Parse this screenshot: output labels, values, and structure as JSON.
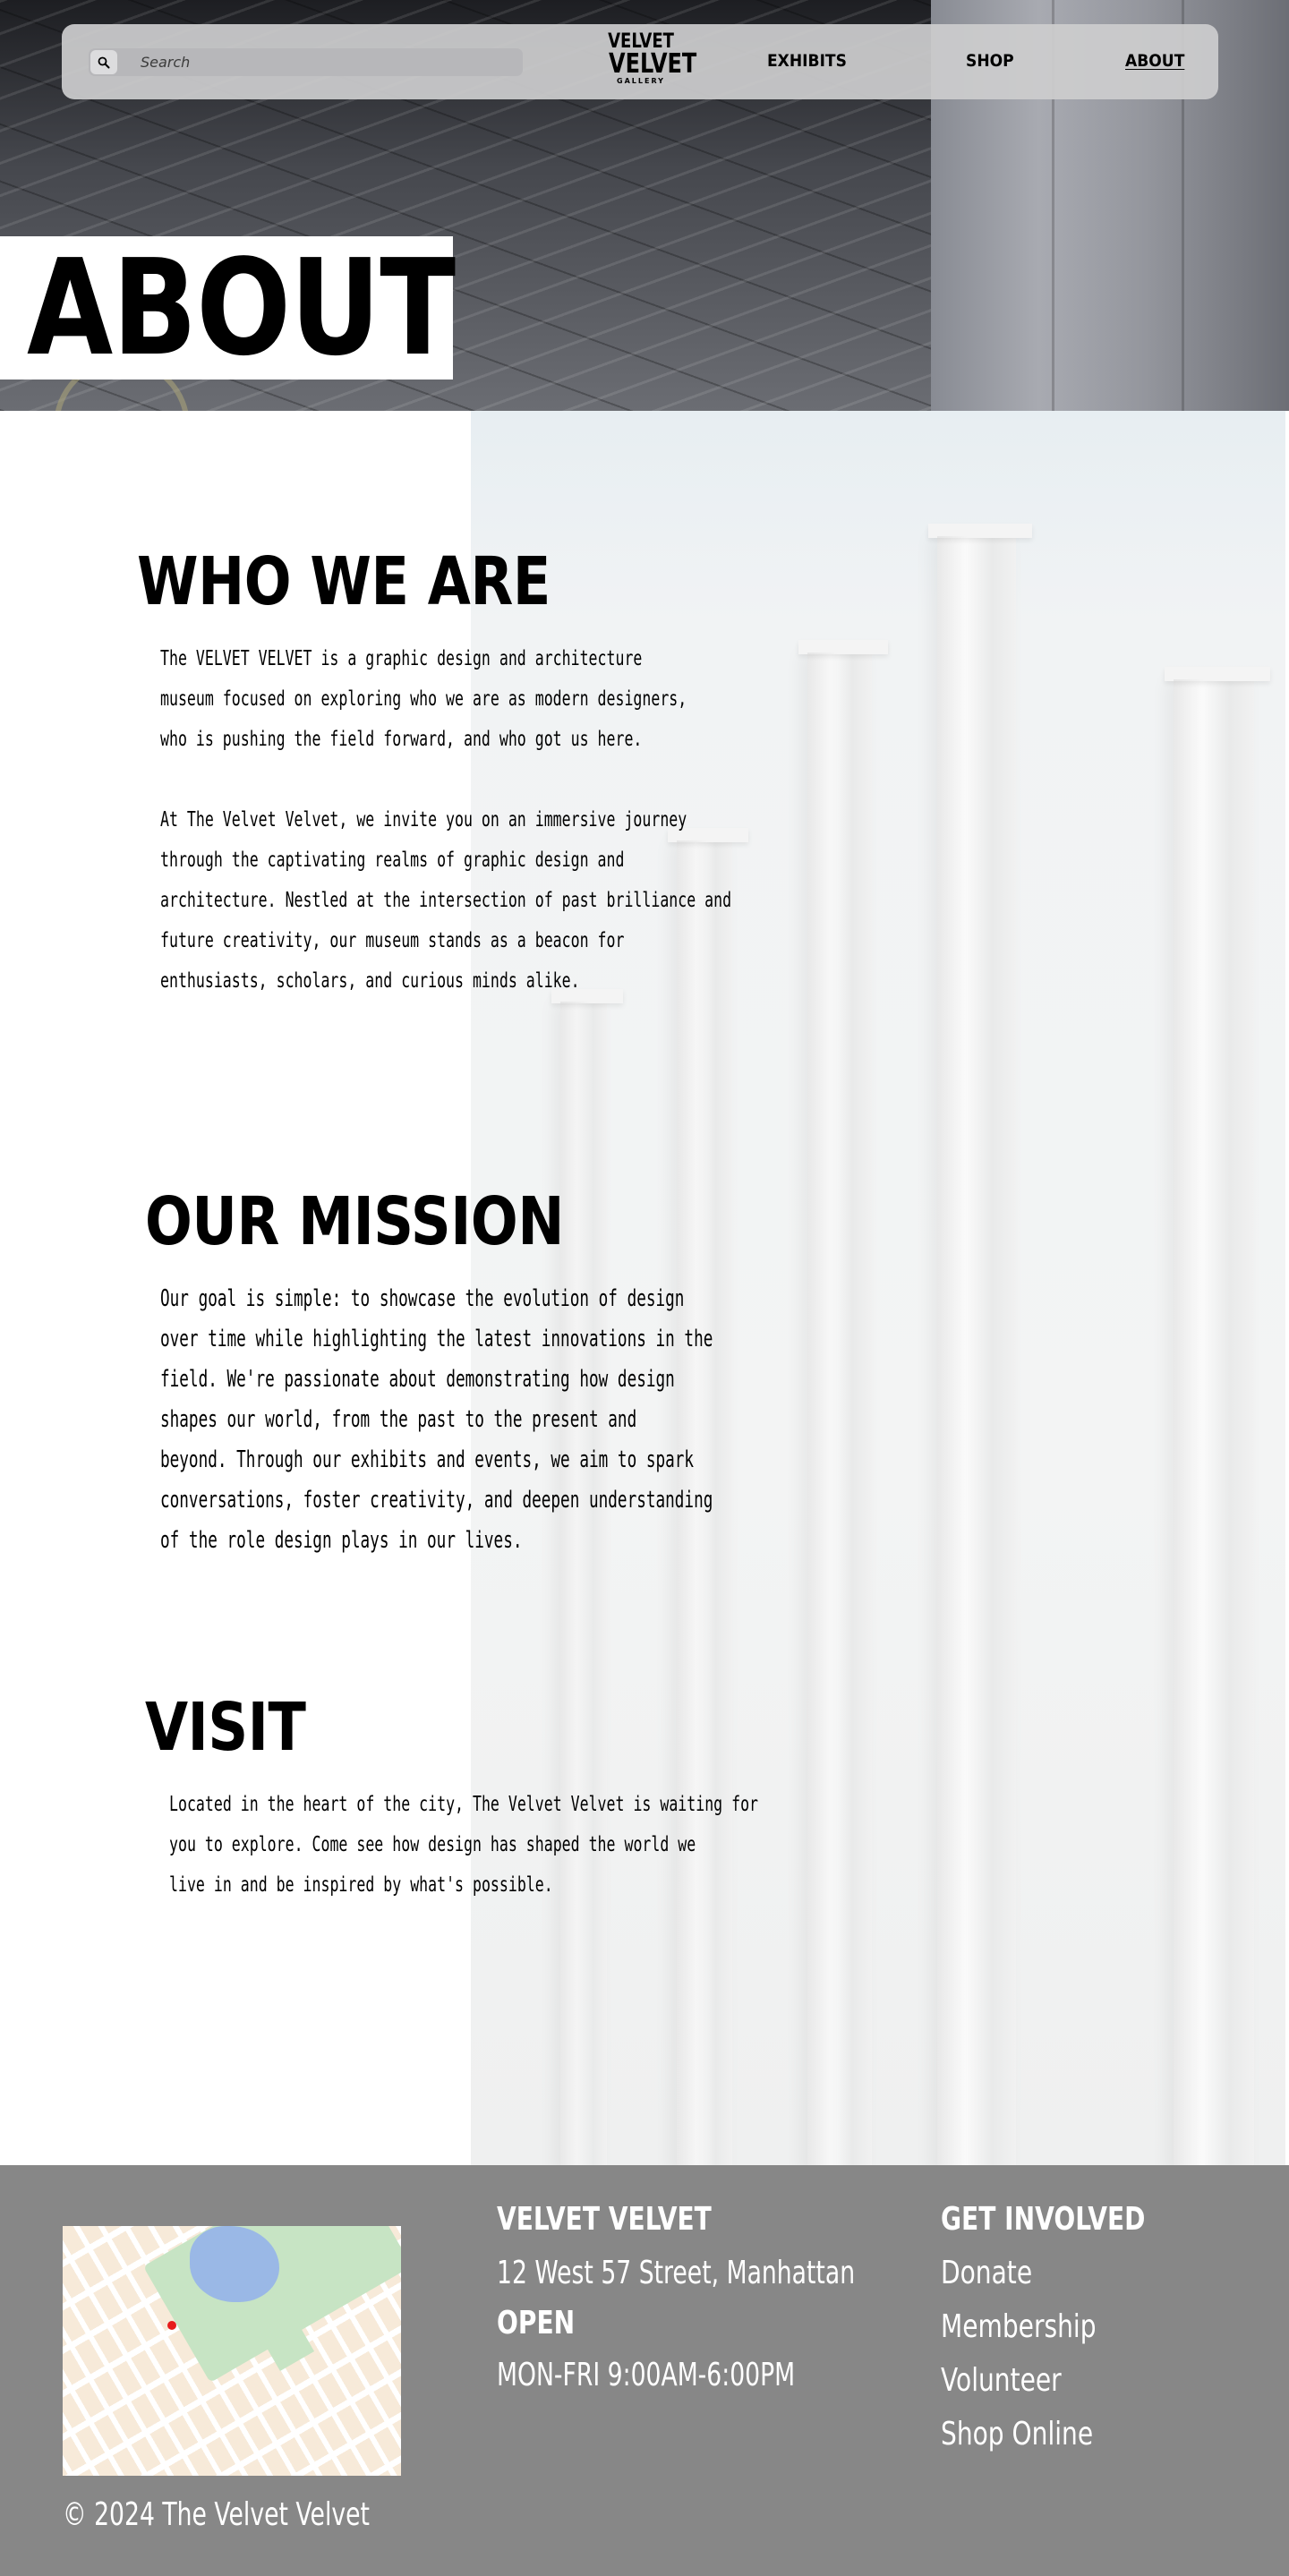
{
  "nav": {
    "search_placeholder": "Search",
    "logo_line1": "VELVET",
    "logo_line2": "VELVET",
    "logo_line3": "GALLERY",
    "links": [
      {
        "label": "EXHIBITS",
        "active": false
      },
      {
        "label": "SHOP",
        "active": false
      },
      {
        "label": "ABOUT",
        "active": true
      }
    ]
  },
  "hero": {
    "title": "ABOUT"
  },
  "sections": {
    "who": {
      "heading": "WHO WE ARE",
      "p1": "The VELVET VELVET is a graphic design and architecture\nmuseum focused on exploring who we are as modern designers,\nwho is pushing the field forward, and who got us here.",
      "p2": "At The Velvet Velvet, we invite you on an immersive journey\nthrough the captivating realms of graphic design and\narchitecture. Nestled at the intersection of past brilliance and\nfuture creativity, our museum stands as a beacon for\nenthusiasts, scholars, and curious minds alike."
    },
    "mission": {
      "heading": "OUR MISSION",
      "p1": "Our goal is simple: to showcase the evolution of design\nover time while highlighting the latest innovations in the\nfield. We're passionate about demonstrating how design\nshapes our world, from the past to the present and\nbeyond. Through our exhibits and events, we aim to spark\nconversations, foster creativity, and deepen understanding\nof the role design plays in our lives."
    },
    "visit": {
      "heading": "VISIT",
      "p1": "Located in the heart of the city, The Velvet Velvet is waiting for\nyou to explore. Come see how design has shaped the world we\nlive in and be inspired by what's possible."
    }
  },
  "footer": {
    "name": "VELVET VELVET",
    "address": "12 West 57 Street, Manhattan",
    "open_label": "OPEN",
    "hours": "MON-FRI 9:00AM-6:00PM",
    "get_involved_title": "GET INVOLVED",
    "links": [
      "Donate",
      "Membership",
      "Volunteer",
      "Shop Online"
    ],
    "copyright": "© 2024 The Velvet Velvet"
  },
  "colors": {
    "footer_bg": "#878787",
    "nav_bg": "#ccccce",
    "text": "#000000",
    "map_pin": "#e61c1c"
  },
  "icons": {
    "search": "search-icon",
    "copyright": "copyright-symbol"
  }
}
